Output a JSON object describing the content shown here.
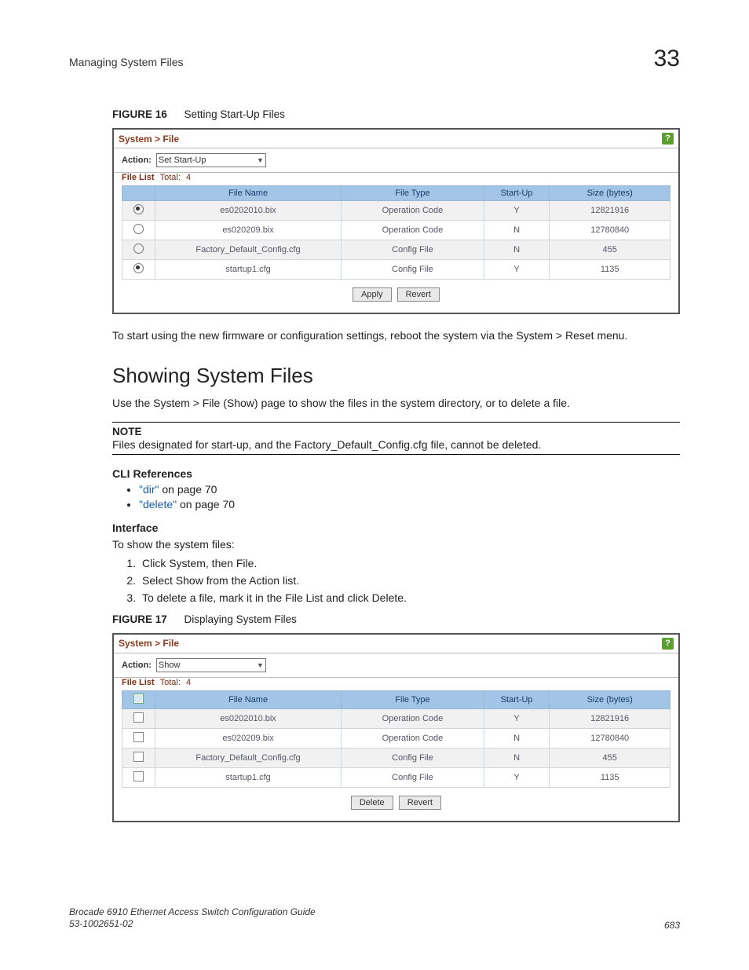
{
  "header": {
    "section": "Managing System Files",
    "chapter_number": "33"
  },
  "fig16": {
    "label": "FIGURE 16",
    "caption": "Setting Start-Up Files"
  },
  "panel1": {
    "breadcrumb": "System > File",
    "help_glyph": "?",
    "action_label": "Action:",
    "action_value": "Set Start-Up",
    "file_list_label": "File List",
    "total_label": "Total:",
    "total_value": "4",
    "columns": {
      "name": "File Name",
      "type": "File Type",
      "startup": "Start-Up",
      "size": "Size (bytes)"
    },
    "rows": [
      {
        "selected": true,
        "name": "es0202010.bix",
        "type": "Operation Code",
        "startup": "Y",
        "size": "12821916"
      },
      {
        "selected": false,
        "name": "es020209.bix",
        "type": "Operation Code",
        "startup": "N",
        "size": "12780840"
      },
      {
        "selected": false,
        "name": "Factory_Default_Config.cfg",
        "type": "Config File",
        "startup": "N",
        "size": "455"
      },
      {
        "selected": true,
        "name": "startup1.cfg",
        "type": "Config File",
        "startup": "Y",
        "size": "1135"
      }
    ],
    "buttons": {
      "apply": "Apply",
      "revert": "Revert"
    }
  },
  "para_after_fig16": "To start using the new firmware or configuration settings, reboot the system via the System > Reset menu.",
  "section_title": "Showing System Files",
  "section_intro": "Use the System > File (Show) page to show the files in the system directory, or to delete a file.",
  "note": {
    "label": "NOTE",
    "text": "Files designated for start-up, and the Factory_Default_Config.cfg file, cannot be deleted."
  },
  "cli": {
    "heading": "CLI References",
    "items": [
      {
        "link": "\"dir\"",
        "suffix": " on page 70"
      },
      {
        "link": "\"delete\"",
        "suffix": " on page 70"
      }
    ]
  },
  "interface": {
    "heading": "Interface",
    "intro": "To show the system files:",
    "steps": [
      "Click System, then File.",
      "Select Show from the Action list.",
      "To delete a file, mark it in the File List and click Delete."
    ]
  },
  "fig17": {
    "label": "FIGURE 17",
    "caption": "Displaying System Files"
  },
  "panel2": {
    "breadcrumb": "System > File",
    "help_glyph": "?",
    "action_label": "Action:",
    "action_value": "Show",
    "file_list_label": "File List",
    "total_label": "Total:",
    "total_value": "4",
    "columns": {
      "name": "File Name",
      "type": "File Type",
      "startup": "Start-Up",
      "size": "Size (bytes)"
    },
    "rows": [
      {
        "name": "es0202010.bix",
        "type": "Operation Code",
        "startup": "Y",
        "size": "12821916"
      },
      {
        "name": "es020209.bix",
        "type": "Operation Code",
        "startup": "N",
        "size": "12780840"
      },
      {
        "name": "Factory_Default_Config.cfg",
        "type": "Config File",
        "startup": "N",
        "size": "455"
      },
      {
        "name": "startup1.cfg",
        "type": "Config File",
        "startup": "Y",
        "size": "1135"
      }
    ],
    "buttons": {
      "delete": "Delete",
      "revert": "Revert"
    }
  },
  "footer": {
    "line1": "Brocade 6910 Ethernet Access Switch Configuration Guide",
    "line2": "53-1002651-02",
    "page": "683"
  }
}
